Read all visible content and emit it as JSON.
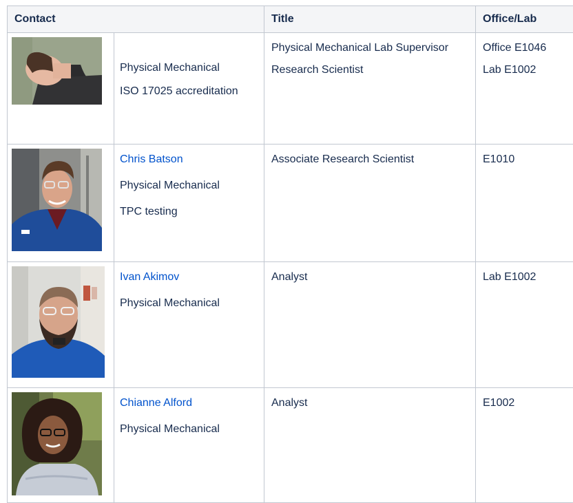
{
  "table": {
    "headers": {
      "contact": "Contact",
      "title": "Title",
      "office": "Office/Lab"
    },
    "rows": [
      {
        "name": "",
        "department": "Physical Mechanical",
        "specialty": "ISO 17025 accreditation",
        "titles": [
          "Physical Mechanical Lab Supervisor",
          "Research Scientist"
        ],
        "offices": [
          "Office E1046",
          "Lab E1002"
        ]
      },
      {
        "name": "Chris Batson",
        "department": "Physical Mechanical",
        "specialty": "TPC testing",
        "titles": [
          "Associate Research Scientist"
        ],
        "offices": [
          "E1010"
        ]
      },
      {
        "name": "Ivan Akimov",
        "department": "Physical Mechanical",
        "titles": [
          "Analyst"
        ],
        "offices": [
          "Lab E1002"
        ]
      },
      {
        "name": "Chianne Alford",
        "department": "Physical Mechanical",
        "titles": [
          "Analyst"
        ],
        "offices": [
          "E1002"
        ]
      }
    ]
  },
  "colors": {
    "link": "#0052cc",
    "border": "#c1c7d0",
    "header_bg": "#f4f5f7",
    "text": "#172b4d"
  }
}
